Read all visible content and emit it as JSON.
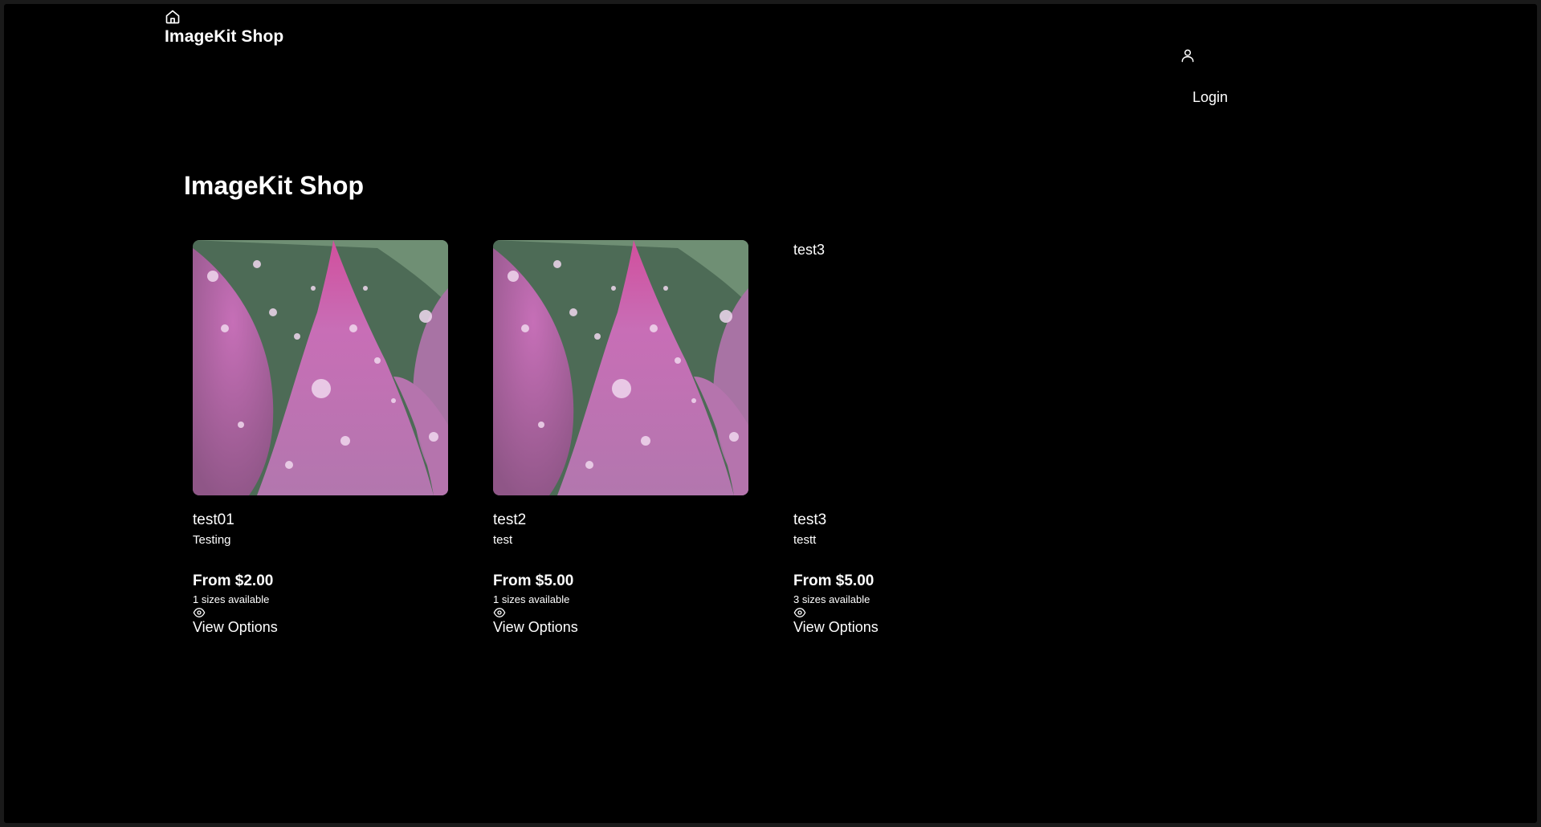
{
  "header": {
    "home_icon": "home-icon",
    "brand": "ImageKit Shop",
    "user_icon": "user-icon",
    "login_label": "Login"
  },
  "main": {
    "title": "ImageKit Shop"
  },
  "products": [
    {
      "image_alt": "test01",
      "has_image": true,
      "name": "test01",
      "description": "Testing",
      "price": "From $2.00",
      "sizes": "1 sizes available",
      "action_icon": "eye-icon",
      "action_label": "View Options"
    },
    {
      "image_alt": "test2",
      "has_image": true,
      "name": "test2",
      "description": "test",
      "price": "From $5.00",
      "sizes": "1 sizes available",
      "action_icon": "eye-icon",
      "action_label": "View Options"
    },
    {
      "image_alt": "test3",
      "has_image": false,
      "name": "test3",
      "description": "testt",
      "price": "From $5.00",
      "sizes": "3 sizes available",
      "action_icon": "eye-icon",
      "action_label": "View Options"
    }
  ],
  "colors": {
    "background": "#000000",
    "text": "#ffffff",
    "petal": "#c56fb3"
  }
}
